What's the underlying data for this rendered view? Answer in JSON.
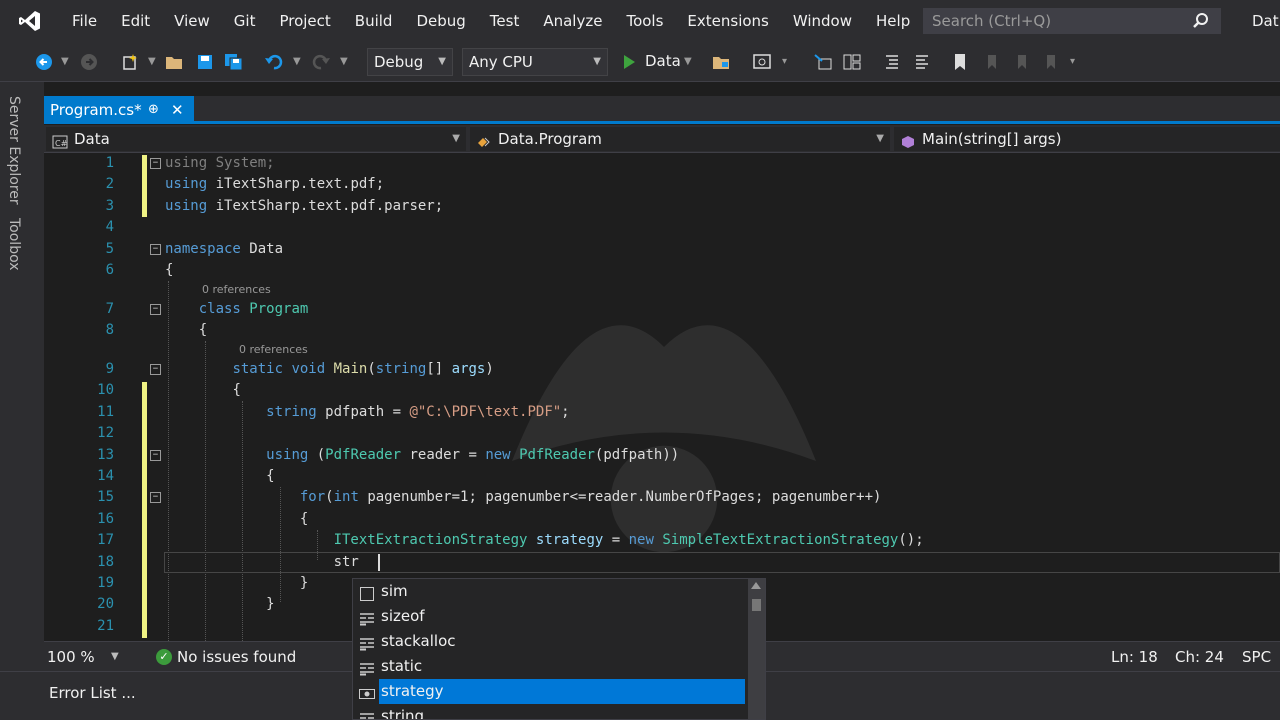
{
  "menu": [
    "File",
    "Edit",
    "View",
    "Git",
    "Project",
    "Build",
    "Debug",
    "Test",
    "Analyze",
    "Tools",
    "Extensions",
    "Window",
    "Help"
  ],
  "search": {
    "placeholder": "Search (Ctrl+Q)"
  },
  "user_label": "Dat",
  "toolbar": {
    "config": "Debug",
    "platform": "Any CPU",
    "start_label": "Data"
  },
  "side_tabs": [
    "Server Explorer",
    "Toolbox"
  ],
  "doc_tab": {
    "label": "Program.cs*",
    "pin": "⊕",
    "close": "✕"
  },
  "navbar": {
    "project": "Data",
    "class": "Data.Program",
    "member": "Main(string[] args)"
  },
  "code": {
    "line_numbers": [
      "1",
      "2",
      "3",
      "4",
      "5",
      "6",
      "7",
      "8",
      "9",
      "10",
      "11",
      "12",
      "13",
      "14",
      "15",
      "16",
      "17",
      "18",
      "19",
      "20",
      "21"
    ],
    "refs": "0 references",
    "l1_kw": "using",
    "l1_rest": " System;",
    "l2_kw": "using",
    "l2_rest": " iTextSharp.text.pdf;",
    "l3_kw": "using",
    "l3_rest": " iTextSharp.text.pdf.parser;",
    "l5_kw": "namespace",
    "l5_rest": " Data",
    "brace_open": "{",
    "brace_close": "}",
    "l7_kw": "class",
    "l7_ty": " Program",
    "l9_kw1": "static",
    "l9_kw2": " void",
    "l9_fn": " Main",
    "l9_p1": "(",
    "l9_kw3": "string",
    "l9_p2": "[] ",
    "l9_pa": "args",
    "l9_p3": ")",
    "l11_kw": "string",
    "l11_mid": " pdfpath = ",
    "l11_st": "@\"C:\\PDF\\text.PDF\"",
    "l11_end": ";",
    "l13_kw": "using",
    "l13_a": " (",
    "l13_ty1": "PdfReader",
    "l13_b": " reader = ",
    "l13_kw2": "new",
    "l13_sp": " ",
    "l13_ty2": "PdfReader",
    "l13_c": "(pdfpath))",
    "l15_kw": "for",
    "l15_a": "(",
    "l15_kw2": "int",
    "l15_b": " pagenumber=1; pagenumber<=reader.NumberOfPages; pagenumber++)",
    "l17_ty1": "ITextExtractionStrategy",
    "l17_a": " ",
    "l17_pa": "strategy",
    "l17_b": " = ",
    "l17_kw": "new",
    "l17_sp": " ",
    "l17_ty2": "SimpleTextExtractionStrategy",
    "l17_c": "();",
    "l18_typed": "str"
  },
  "completion": [
    {
      "label": "sim",
      "icon": "snippet-icon"
    },
    {
      "label": "sizeof",
      "icon": "keyword-icon"
    },
    {
      "label": "stackalloc",
      "icon": "keyword-icon"
    },
    {
      "label": "static",
      "icon": "keyword-icon"
    },
    {
      "label": "strategy",
      "icon": "local-variable-icon",
      "selected": true
    },
    {
      "label": "string",
      "icon": "keyword-icon"
    }
  ],
  "status": {
    "zoom": "100 %",
    "issues": "No issues found",
    "line": "Ln: 18",
    "col": "Ch: 24",
    "whitespace": "SPC"
  },
  "error_list": {
    "title": "Error List ..."
  },
  "colors": {
    "accent": "#007acc",
    "keyword": "#569cd6",
    "type": "#4ec9b0",
    "string": "#d69d85",
    "line_number": "#2b91af",
    "selection": "#0078d7"
  }
}
